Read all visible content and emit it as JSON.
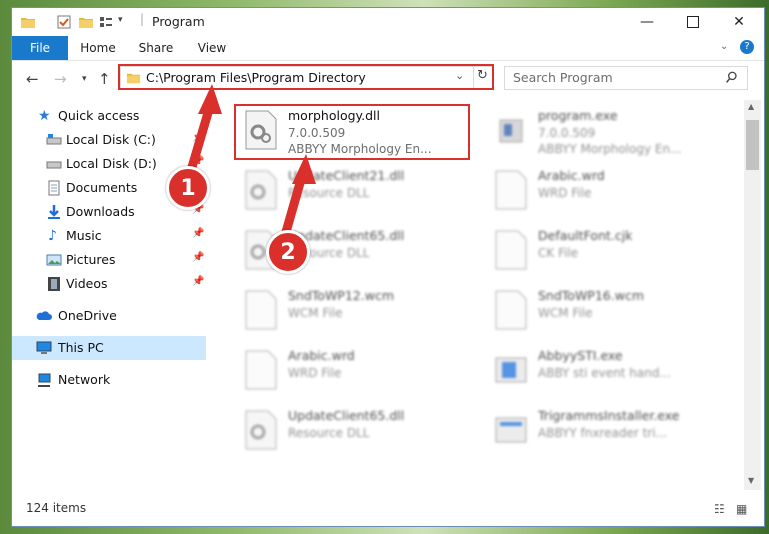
{
  "window": {
    "title": "Program"
  },
  "ribbon": {
    "tabs": [
      "File",
      "Home",
      "Share",
      "View"
    ]
  },
  "address": {
    "path": "C:\\Program Files\\Program Directory",
    "search_placeholder": "Search Program"
  },
  "sidebar": {
    "items": [
      {
        "label": "Quick access"
      },
      {
        "label": "Local Disk (C:)"
      },
      {
        "label": "Local Disk (D:)"
      },
      {
        "label": "Documents"
      },
      {
        "label": "Downloads"
      },
      {
        "label": "Music"
      },
      {
        "label": "Pictures"
      },
      {
        "label": "Videos"
      },
      {
        "label": "OneDrive"
      },
      {
        "label": "This PC"
      },
      {
        "label": "Network"
      }
    ]
  },
  "files": [
    {
      "name": "morphology.dll",
      "line2": "7.0.0.509",
      "line3": "ABBYY Morphology En..."
    },
    {
      "name": "program.exe",
      "line2": "7.0.0.509",
      "line3": "ABBYY Morphology En..."
    },
    {
      "name": "UpdateClient21.dll",
      "line2": "Resource DLL"
    },
    {
      "name": "Arabic.wrd",
      "line2": "WRD File"
    },
    {
      "name": "UpdateClient65.dll",
      "line2": "Resource DLL"
    },
    {
      "name": "DefaultFont.cjk",
      "line2": "CK File"
    },
    {
      "name": "SndToWP12.wcm",
      "line2": "WCM File"
    },
    {
      "name": "SndToWP16.wcm",
      "line2": "WCM File"
    },
    {
      "name": "Arabic.wrd",
      "line2": "WRD File"
    },
    {
      "name": "AbbyySTI.exe",
      "line2": "ABBY sti event hand..."
    },
    {
      "name": "UpdateClient65.dll",
      "line2": "Resource DLL"
    },
    {
      "name": "TrigrammsInstaller.exe",
      "line2": "ABBYY fnxreader tri..."
    }
  ],
  "status": {
    "count": "124 items"
  },
  "callouts": [
    "1",
    "2"
  ],
  "colors": {
    "accent": "#1979ca",
    "highlight": "#d9302c",
    "selection": "#cce8ff"
  }
}
